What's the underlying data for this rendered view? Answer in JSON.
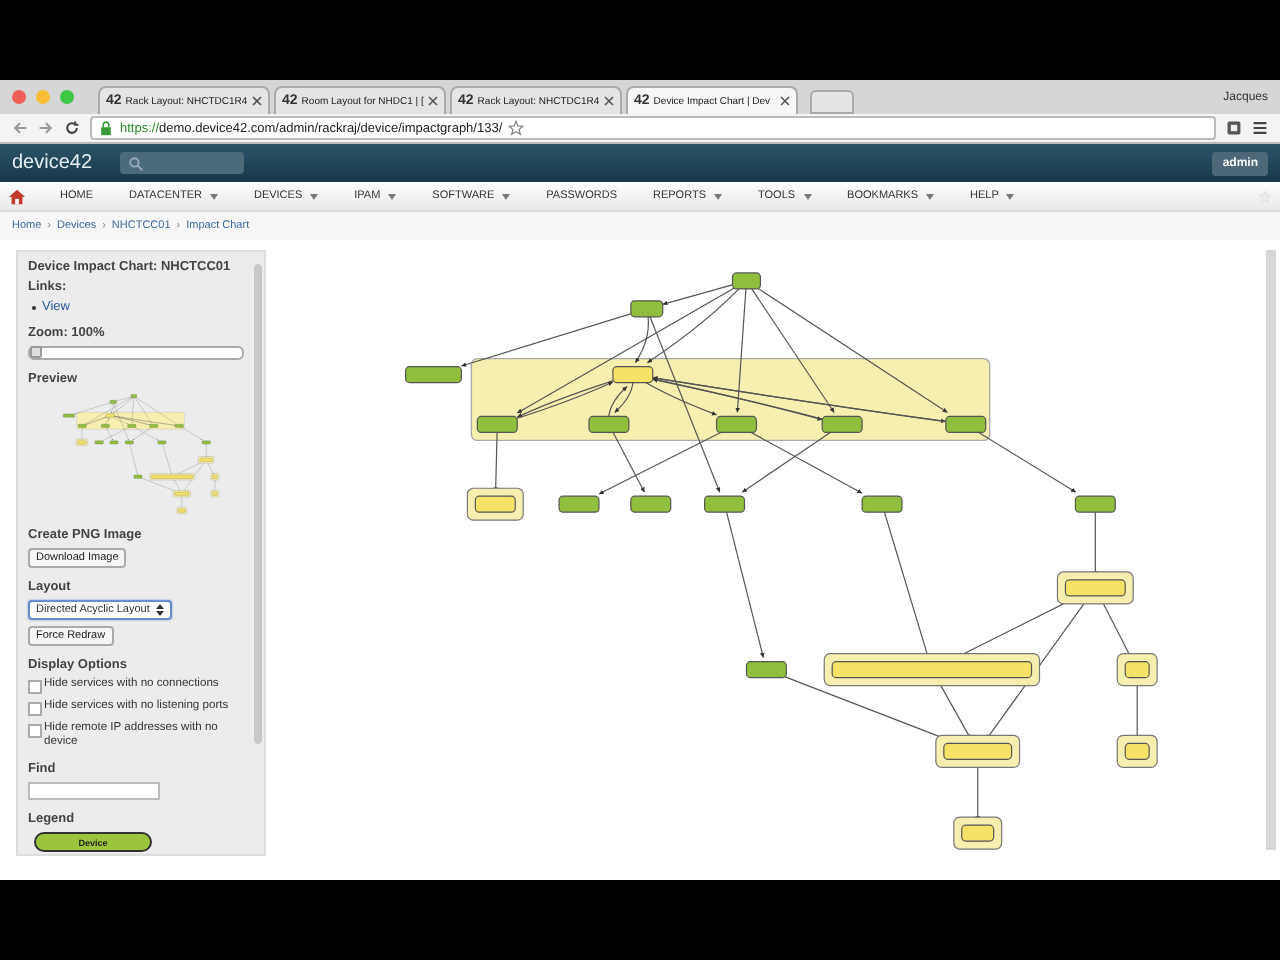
{
  "browser": {
    "tabs": [
      {
        "favicon": "42",
        "title": "Rack Layout: NHCTDC1R4",
        "selected": false
      },
      {
        "favicon": "42",
        "title": "Room Layout for NHDC1 | [",
        "selected": false
      },
      {
        "favicon": "42",
        "title": "Rack Layout: NHCTDC1R4",
        "selected": false
      },
      {
        "favicon": "42",
        "title": "Device Impact Chart | Dev",
        "selected": true
      }
    ],
    "user": "Jacques",
    "url": {
      "scheme": "https://",
      "rest": "demo.device42.com/admin/rackraj/device/impactgraph/133/"
    }
  },
  "app": {
    "logo": "device42",
    "user_button": "admin"
  },
  "nav": [
    {
      "label": "HOME",
      "dropdown": false
    },
    {
      "label": "DATACENTER",
      "dropdown": true
    },
    {
      "label": "DEVICES",
      "dropdown": true
    },
    {
      "label": "IPAM",
      "dropdown": true
    },
    {
      "label": "SOFTWARE",
      "dropdown": true
    },
    {
      "label": "PASSWORDS",
      "dropdown": false
    },
    {
      "label": "REPORTS",
      "dropdown": true
    },
    {
      "label": "TOOLS",
      "dropdown": true
    },
    {
      "label": "BOOKMARKS",
      "dropdown": true
    },
    {
      "label": "HELP",
      "dropdown": true
    }
  ],
  "breadcrumb": {
    "items": [
      "Home",
      "Devices",
      "NHCTCC01",
      "Impact Chart"
    ],
    "separator": "›"
  },
  "sidebar": {
    "title": "Device Impact Chart: NHCTCC01",
    "links_label": "Links:",
    "links": [
      "View"
    ],
    "zoom_label": "Zoom: 100%",
    "zoom": {
      "level": 0
    },
    "preview_label": "Preview",
    "png_heading": "Create PNG Image",
    "download_button": "Download Image",
    "layout_heading": "Layout",
    "layout_select": "Directed Acyclic Layout",
    "redraw_button": "Force Redraw",
    "options_heading": "Display Options",
    "options": [
      {
        "label": "Hide services with no connections",
        "checked": false
      },
      {
        "label": "Hide services with no listening ports",
        "checked": false
      },
      {
        "label": "Hide remote IP addresses with no device",
        "checked": false
      }
    ],
    "find_heading": "Find",
    "legend_heading": "Legend",
    "legend": [
      {
        "label": "Device"
      }
    ]
  }
}
